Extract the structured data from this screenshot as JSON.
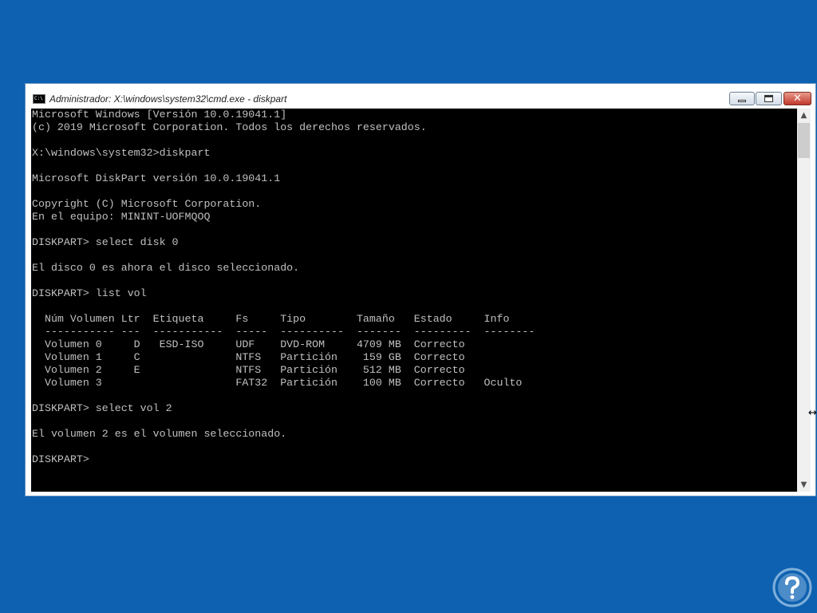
{
  "window": {
    "title": "Administrador: X:\\windows\\system32\\cmd.exe - diskpart",
    "icon_label": "C:\\",
    "controls": {
      "minimize_icon": "minimize-icon",
      "maximize_icon": "maximize-icon",
      "close_icon": "close-icon",
      "close_glyph": "✕"
    }
  },
  "console": {
    "lines": [
      "Microsoft Windows [Versión 10.0.19041.1]",
      "(c) 2019 Microsoft Corporation. Todos los derechos reservados.",
      "",
      "X:\\windows\\system32>diskpart",
      "",
      "Microsoft DiskPart versión 10.0.19041.1",
      "",
      "Copyright (C) Microsoft Corporation.",
      "En el equipo: MININT-UOFMQOQ",
      "",
      "DISKPART> select disk 0",
      "",
      "El disco 0 es ahora el disco seleccionado.",
      "",
      "DISKPART> list vol",
      "",
      "  Núm Volumen Ltr  Etiqueta     Fs     Tipo        Tamaño   Estado     Info",
      "  ----------- ---  -----------  -----  ----------  -------  ---------  --------",
      "  Volumen 0     D   ESD-ISO     UDF    DVD-ROM     4709 MB  Correcto",
      "  Volumen 1     C               NTFS   Partición    159 GB  Correcto",
      "  Volumen 2     E               NTFS   Partición    512 MB  Correcto",
      "  Volumen 3                     FAT32  Partición    100 MB  Correcto   Oculto",
      "",
      "DISKPART> select vol 2",
      "",
      "El volumen 2 es el volumen seleccionado.",
      "",
      "DISKPART>"
    ]
  },
  "scrollbar": {
    "up_arrow": "▲",
    "down_arrow": "▼"
  },
  "colors": {
    "desktop": "#0e61b0",
    "console_bg": "#000000",
    "console_fg": "#c0c0c0"
  }
}
